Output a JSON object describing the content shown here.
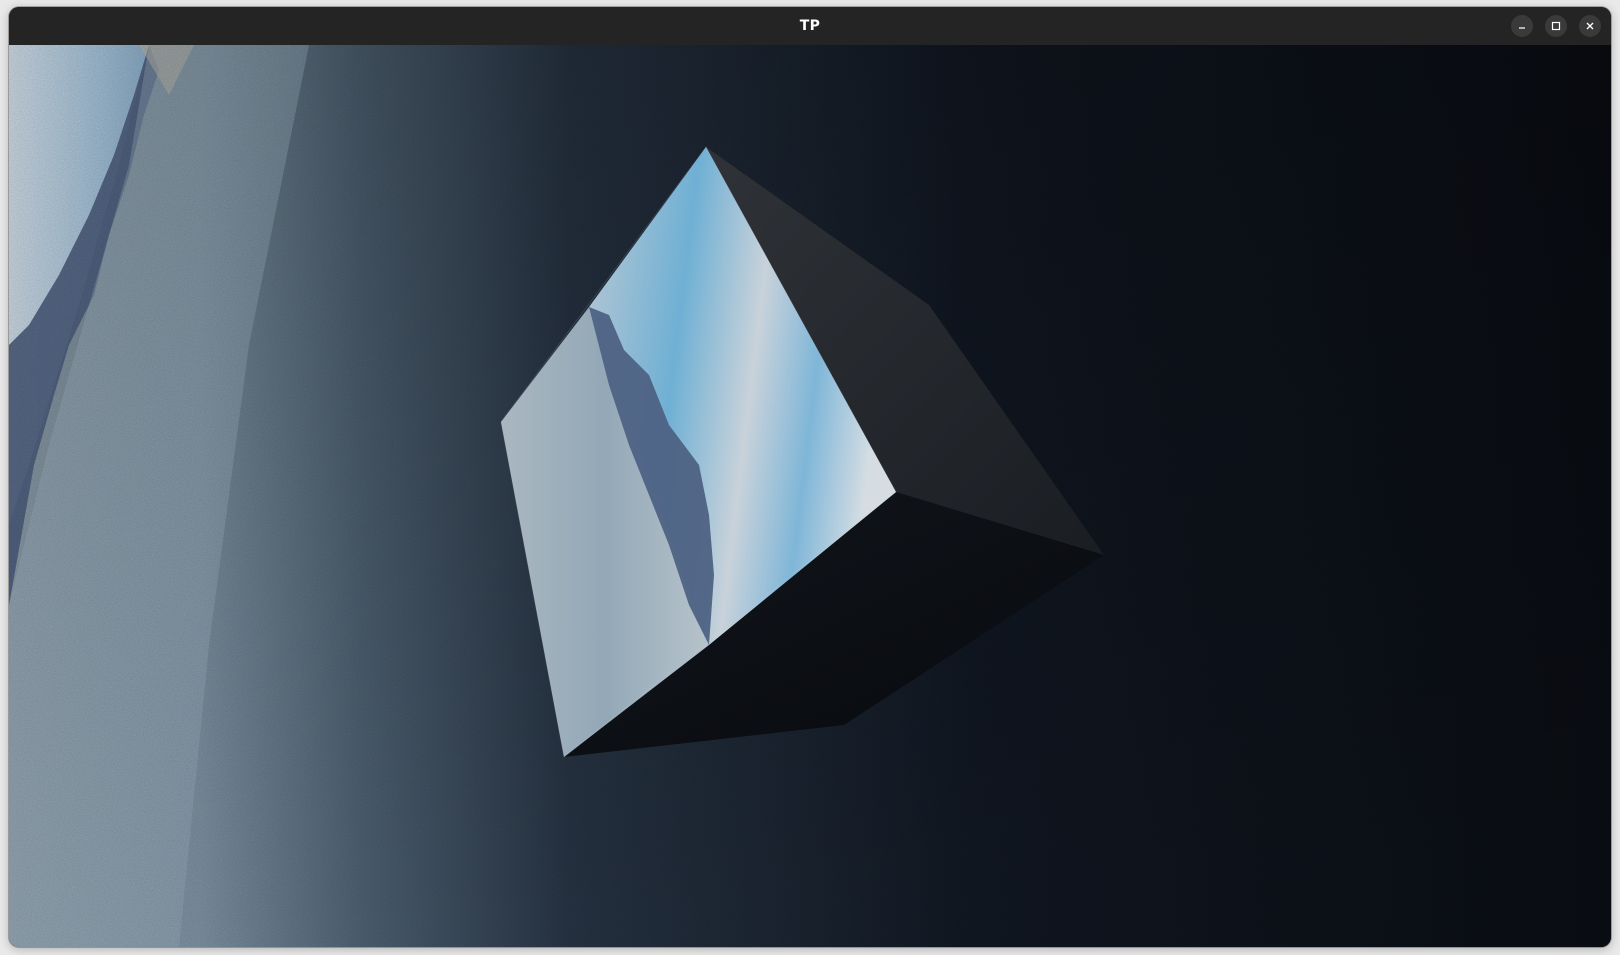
{
  "window": {
    "title": "TP"
  },
  "controls": {
    "icons": [
      "minimize-icon",
      "maximize-icon",
      "close-icon"
    ]
  },
  "scene": {
    "description_colors": {
      "ocean_dark": "#0b0f15",
      "ocean_light": "#8fa3b2",
      "sky_light": "#cfd7df",
      "sky_blue": "#6fb3d6",
      "mountain": "#4c5d7c"
    }
  }
}
